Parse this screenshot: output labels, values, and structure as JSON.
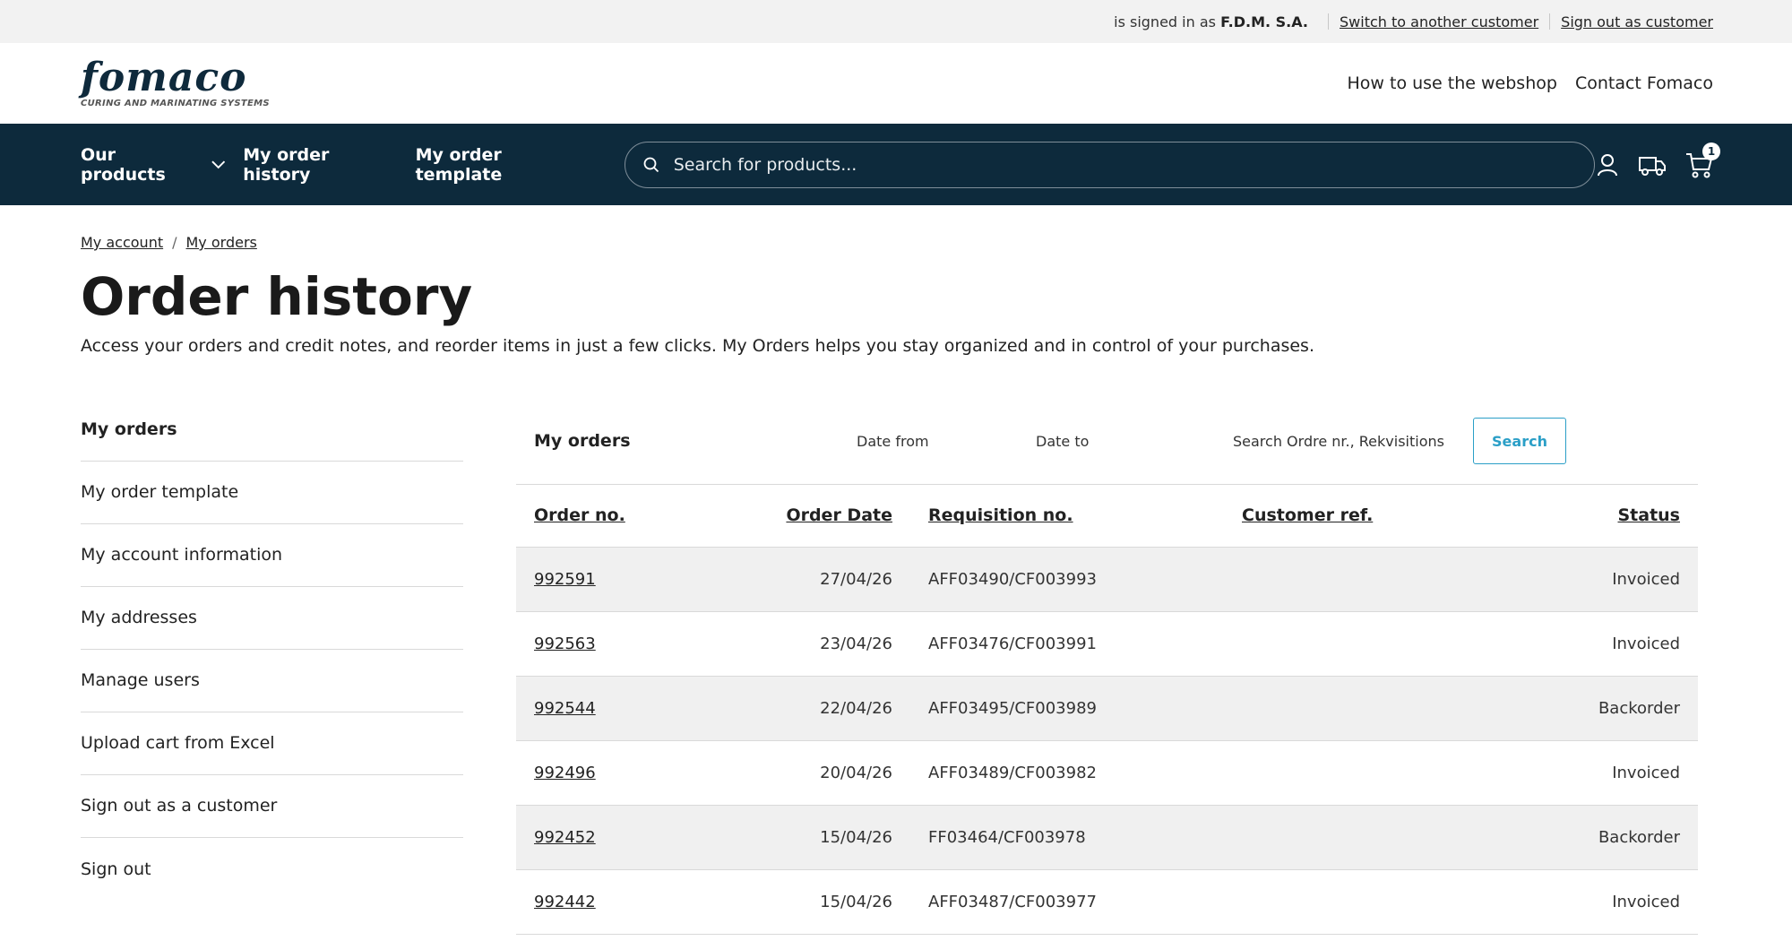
{
  "topbar": {
    "signed_in_prefix": "is signed in as",
    "customer_name": "F.D.M. S.A.",
    "switch_link": "Switch to another customer",
    "signout_link": "Sign out as customer"
  },
  "header": {
    "logo_text": "fomaco",
    "logo_tagline": "CURING AND MARINATING SYSTEMS",
    "links": [
      "How to use the webshop",
      "Contact Fomaco"
    ]
  },
  "nav": {
    "products": "Our products",
    "order_history": "My order history",
    "order_template": "My order template",
    "search_placeholder": "Search for products...",
    "cart_count": "1"
  },
  "breadcrumb": [
    "My account",
    "My orders"
  ],
  "page": {
    "title": "Order history",
    "intro": "Access your orders and credit notes, and reorder items in just a few clicks. My Orders helps you stay organized and in control of your purchases."
  },
  "sidebar": {
    "items": [
      "My orders",
      "My order template",
      "My account information",
      "My addresses",
      "Manage users",
      "Upload cart from Excel",
      "Sign out as a customer",
      "Sign out"
    ]
  },
  "orders": {
    "title": "My orders",
    "date_from_placeholder": "Date from",
    "date_to_placeholder": "Date to",
    "search_placeholder": "Search Ordre nr., Rekvisitions r",
    "search_button": "Search",
    "columns": [
      "Order no.",
      "Order Date",
      "Requisition no.",
      "Customer ref.",
      "Status"
    ],
    "rows": [
      {
        "order_no": "992591",
        "date": "27/04/26",
        "requisition": "AFF03490/CF003993",
        "customer_ref": "",
        "status": "Invoiced"
      },
      {
        "order_no": "992563",
        "date": "23/04/26",
        "requisition": "AFF03476/CF003991",
        "customer_ref": "",
        "status": "Invoiced"
      },
      {
        "order_no": "992544",
        "date": "22/04/26",
        "requisition": "AFF03495/CF003989",
        "customer_ref": "",
        "status": "Backorder"
      },
      {
        "order_no": "992496",
        "date": "20/04/26",
        "requisition": "AFF03489/CF003982",
        "customer_ref": "",
        "status": "Invoiced"
      },
      {
        "order_no": "992452",
        "date": "15/04/26",
        "requisition": "FF03464/CF003978",
        "customer_ref": "",
        "status": "Backorder"
      },
      {
        "order_no": "992442",
        "date": "15/04/26",
        "requisition": "AFF03487/CF003977",
        "customer_ref": "",
        "status": "Invoiced"
      }
    ]
  },
  "colors": {
    "navy": "#0d2a3c",
    "accent": "#2b9fc7",
    "row_alt": "#f0f0f0"
  }
}
